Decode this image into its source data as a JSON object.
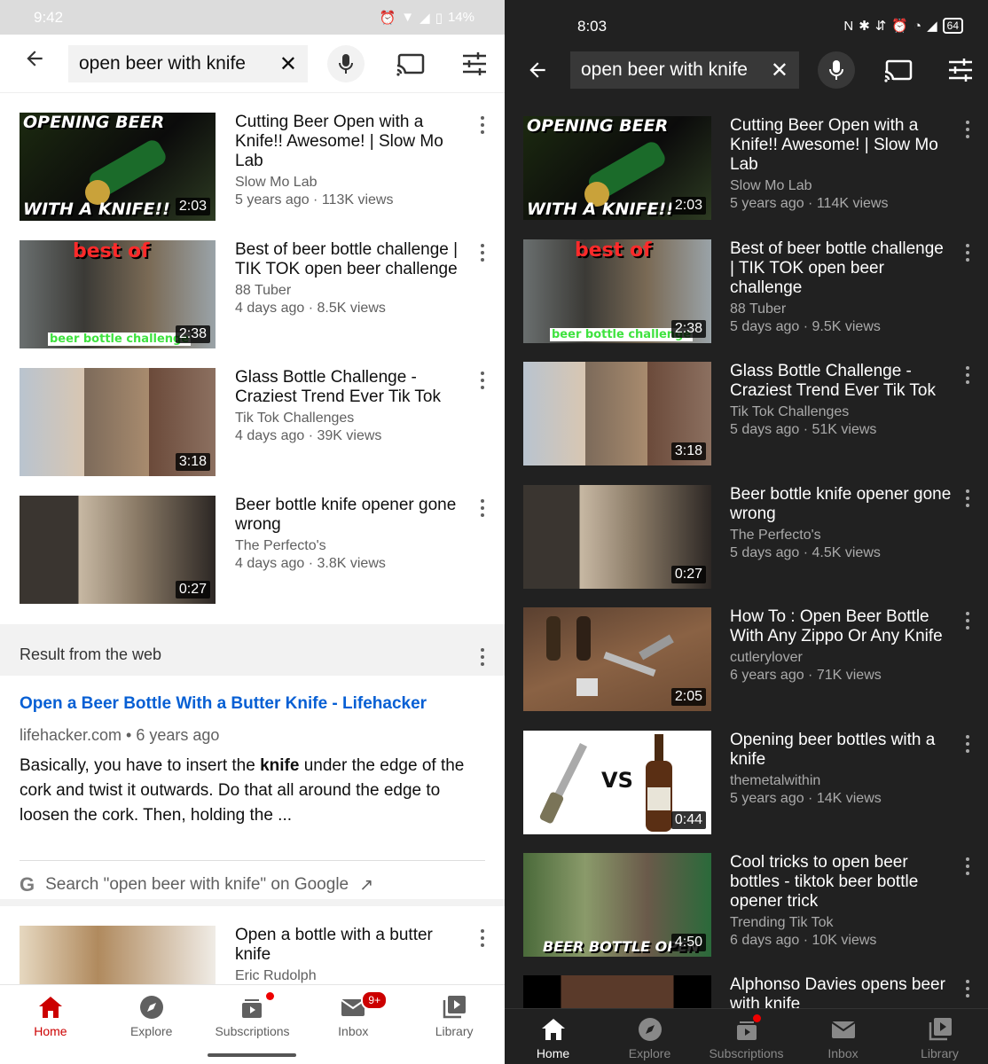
{
  "light": {
    "status": {
      "time": "9:42",
      "battery": "14%"
    },
    "search": {
      "query": "open beer with knife"
    },
    "videos": [
      {
        "title": "Cutting Beer Open with a Knife!! Awesome! | Slow Mo Lab",
        "channel": "Slow Mo Lab",
        "stats": "5 years ago · 113K views",
        "duration": "2:03",
        "thumb_top": "OPENING BEER",
        "thumb_bottom": "WITH A KNIFE!!"
      },
      {
        "title": "Best of beer bottle challenge | TIK TOK open beer challenge",
        "channel": "88 Tuber",
        "stats": "4 days ago · 8.5K views",
        "duration": "2:38",
        "thumb_top": "best of",
        "thumb_bottom": "beer bottle challenge"
      },
      {
        "title": "Glass Bottle Challenge - Craziest Trend Ever Tik Tok",
        "channel": "Tik Tok Challenges",
        "stats": "4 days ago · 39K views",
        "duration": "3:18"
      },
      {
        "title": "Beer bottle knife opener gone wrong",
        "channel": "The Perfecto's",
        "stats": "4 days ago · 3.8K views",
        "duration": "0:27"
      }
    ],
    "web": {
      "header": "Result from the web",
      "link": "Open a Beer Bottle With a Butter Knife - Lifehacker",
      "source": "lifehacker.com • 6 years ago",
      "snippet_before": "Basically, you have to insert the ",
      "snippet_bold": "knife",
      "snippet_after": " under the edge of the cork and twist it outwards. Do that all around the edge to loosen the cork. Then, holding the  ...",
      "google_label": "Search \"open beer with knife\" on Google"
    },
    "extra_video": {
      "title": "Open a bottle with a butter knife",
      "channel": "Eric Rudolph"
    },
    "nav": [
      {
        "label": "Home",
        "icon": "home-icon"
      },
      {
        "label": "Explore",
        "icon": "compass-icon"
      },
      {
        "label": "Subscriptions",
        "icon": "subscriptions-icon"
      },
      {
        "label": "Inbox",
        "icon": "inbox-icon",
        "badge": "9+"
      },
      {
        "label": "Library",
        "icon": "library-icon"
      }
    ]
  },
  "dark": {
    "status": {
      "time": "8:03",
      "battery": "64"
    },
    "search": {
      "query": "open beer with knife"
    },
    "videos": [
      {
        "title": "Cutting Beer Open with a Knife!! Awesome! | Slow Mo Lab",
        "channel": "Slow Mo Lab",
        "stats": "5 years ago · 114K views",
        "duration": "2:03",
        "thumb_top": "OPENING BEER",
        "thumb_bottom": "WITH A KNIFE!!"
      },
      {
        "title": "Best of beer bottle challenge | TIK TOK open beer challenge",
        "channel": "88 Tuber",
        "stats": "5 days ago · 9.5K views",
        "duration": "2:38",
        "thumb_top": "best of",
        "thumb_bottom": "beer bottle challenge"
      },
      {
        "title": "Glass Bottle Challenge - Craziest Trend Ever Tik Tok",
        "channel": "Tik Tok Challenges",
        "stats": "5 days ago · 51K views",
        "duration": "3:18"
      },
      {
        "title": "Beer bottle knife opener gone wrong",
        "channel": "The Perfecto's",
        "stats": "5 days ago · 4.5K views",
        "duration": "0:27"
      },
      {
        "title": "How To : Open Beer Bottle With Any Zippo Or Any Knife",
        "channel": "cutlerylover",
        "stats": "6 years ago · 71K views",
        "duration": "2:05"
      },
      {
        "title": "Opening beer bottles with a knife",
        "channel": "themetalwithin",
        "stats": "5 years ago · 14K views",
        "duration": "0:44",
        "thumb_vs": "VS"
      },
      {
        "title": "Cool tricks to open beer bottles - tiktok beer bottle opener trick",
        "channel": "Trending Tik Tok",
        "stats": "6 days ago · 10K views",
        "duration": "4:50",
        "thumb_bottom": "BEER BOTTLE OPEN"
      },
      {
        "title": "Alphonso Davies opens beer with knife"
      }
    ],
    "nav": [
      {
        "label": "Home",
        "icon": "home-icon"
      },
      {
        "label": "Explore",
        "icon": "compass-icon"
      },
      {
        "label": "Subscriptions",
        "icon": "subscriptions-icon"
      },
      {
        "label": "Inbox",
        "icon": "inbox-icon"
      },
      {
        "label": "Library",
        "icon": "library-icon"
      }
    ]
  }
}
